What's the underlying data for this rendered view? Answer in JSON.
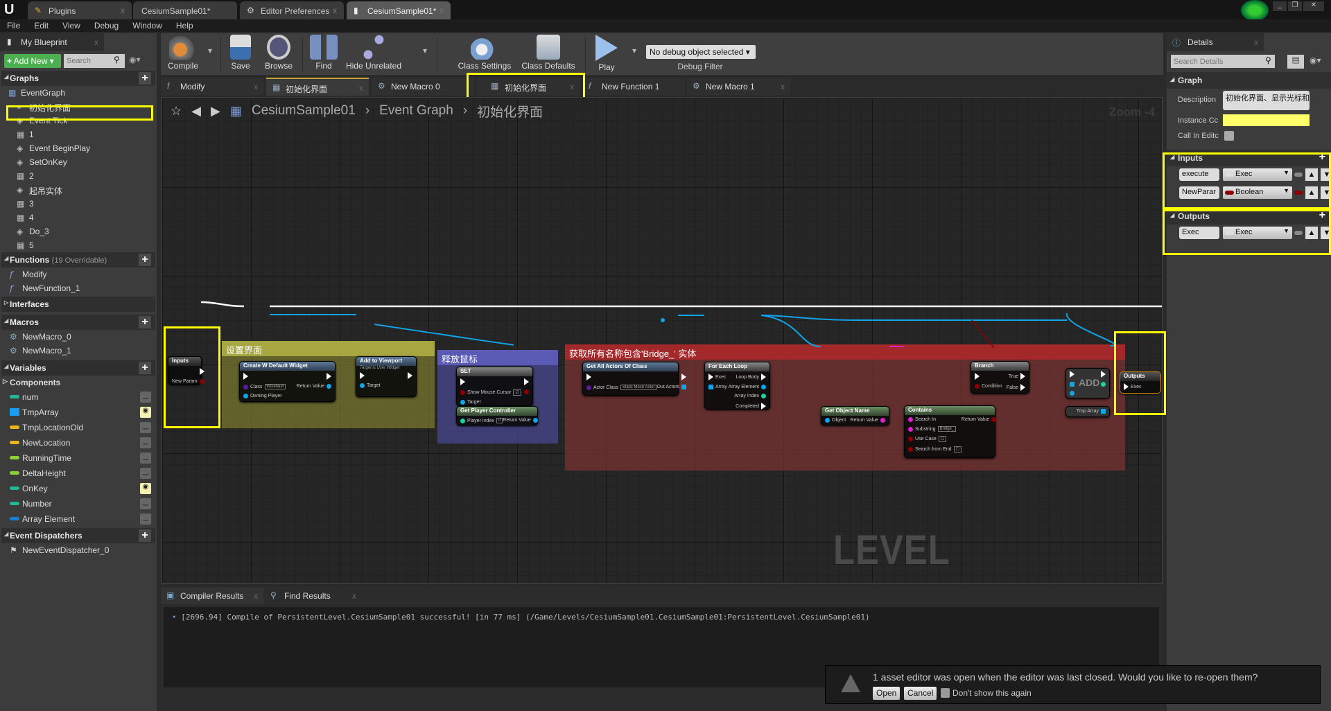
{
  "window_tabs": [
    {
      "label": "Plugins",
      "icon": "plug-icon"
    },
    {
      "label": "CesiumSample01*",
      "icon": ""
    },
    {
      "label": "Editor Preferences",
      "icon": "preferences-icon"
    },
    {
      "label": "CesiumSample01*",
      "icon": "blueprint-book-icon",
      "active": true
    }
  ],
  "menu": [
    "File",
    "Edit",
    "View",
    "Debug",
    "Window",
    "Help"
  ],
  "my_blueprint": {
    "tab": "My Blueprint",
    "add_new": "Add New",
    "search_placeholder": "Search",
    "graphs": {
      "title": "Graphs",
      "root": "EventGraph",
      "items": [
        {
          "label": "初始化界面",
          "icon": "custom-event-icon",
          "highlighted": true
        },
        {
          "label": "Event Tick",
          "icon": "event-icon"
        },
        {
          "label": "1",
          "icon": "comment-icon"
        },
        {
          "label": "Event BeginPlay",
          "icon": "event-icon"
        },
        {
          "label": "SetOnKey",
          "icon": "event-icon"
        },
        {
          "label": "2",
          "icon": "comment-icon"
        },
        {
          "label": "起吊实体",
          "icon": "event-icon"
        },
        {
          "label": "3",
          "icon": "comment-icon"
        },
        {
          "label": "4",
          "icon": "comment-icon"
        },
        {
          "label": "Do_3",
          "icon": "event-icon"
        },
        {
          "label": "5",
          "icon": "comment-icon"
        }
      ]
    },
    "functions": {
      "title": "Functions",
      "sub": "(19 Overridable)",
      "items": [
        "Modify",
        "NewFunction_1"
      ]
    },
    "interfaces": {
      "title": "Interfaces"
    },
    "macros": {
      "title": "Macros",
      "items": [
        "NewMacro_0",
        "NewMacro_1"
      ]
    },
    "variables": {
      "title": "Variables",
      "components": "Components",
      "items": [
        {
          "name": "num",
          "color": "#1fb99a",
          "public": false
        },
        {
          "name": "TmpArray",
          "color": "#1a9cf0",
          "array": true,
          "public": true
        },
        {
          "name": "TmpLocationOld",
          "color": "#e8b51c",
          "public": false
        },
        {
          "name": "NewLocation",
          "color": "#e8b51c",
          "public": false
        },
        {
          "name": "RunningTime",
          "color": "#8bd23a",
          "public": false
        },
        {
          "name": "DeltaHeight",
          "color": "#8bd23a",
          "public": false
        },
        {
          "name": "OnKey",
          "color": "#1fb99a",
          "public": true
        },
        {
          "name": "Number",
          "color": "#1fb99a",
          "public": false
        },
        {
          "name": "Array Element",
          "color": "#1a7fd0",
          "public": false
        }
      ]
    },
    "dispatchers": {
      "title": "Event Dispatchers",
      "items": [
        "NewEventDispatcher_0"
      ]
    }
  },
  "toolbar": {
    "compile": "Compile",
    "save": "Save",
    "browse": "Browse",
    "find": "Find",
    "hide_unrelated": "Hide Unrelated",
    "class_settings": "Class Settings",
    "class_defaults": "Class Defaults",
    "play": "Play",
    "debug_select": "No debug object selected",
    "debug_filter": "Debug Filter"
  },
  "graph_tabs": [
    {
      "label": "Modify",
      "icon": "function-icon"
    },
    {
      "label": "初始化界面",
      "icon": "graph-icon",
      "active": true
    },
    {
      "label": "New Macro 0",
      "icon": "macro-icon"
    },
    {
      "label": "初始化界面",
      "icon": "graph-icon",
      "highlighted": true
    },
    {
      "label": "New Function 1",
      "icon": "function-icon"
    },
    {
      "label": "New Macro 1",
      "icon": "macro-icon"
    }
  ],
  "breadcrumb": [
    "CesiumSample01",
    "Event Graph",
    "初始化界面"
  ],
  "zoom": "Zoom -4",
  "watermark": "LEVEL BLUEPRINT",
  "comments": {
    "setup": "设置界面",
    "release": "释放鼠标",
    "find": "获取所有名称包含'Bridge_' 实体"
  },
  "nodes": {
    "inputs": {
      "title": "Inputs",
      "style": "dark",
      "in": [],
      "out": [
        {
          "label": "",
          "type": "exec"
        },
        {
          "label": "New Param",
          "type": "bool"
        }
      ]
    },
    "create_widget": {
      "title": "Create W Default Widget",
      "style": "fn",
      "in": [
        {
          "label": "",
          "type": "exec"
        },
        {
          "label": "Class",
          "type": "class",
          "value": "WDefault"
        },
        {
          "label": "Owning Player",
          "type": "object"
        }
      ],
      "out": [
        {
          "label": "",
          "type": "exec"
        },
        {
          "label": "Return Value",
          "type": "object"
        }
      ]
    },
    "add_viewport": {
      "title": "Add to Viewport",
      "subtitle": "Target is User Widget",
      "style": "fn",
      "in": [
        {
          "label": "",
          "type": "exec"
        },
        {
          "label": "Target",
          "type": "object"
        }
      ],
      "out": [
        {
          "label": "",
          "type": "exec"
        }
      ]
    },
    "set": {
      "title": "SET",
      "style": "grey",
      "in": [
        {
          "label": "",
          "type": "exec"
        },
        {
          "label": "Show Mouse Cursor",
          "type": "bool",
          "value": "☑"
        },
        {
          "label": "Target",
          "type": "object"
        }
      ],
      "out": [
        {
          "label": "",
          "type": "exec"
        },
        {
          "label": "",
          "type": "bool"
        }
      ]
    },
    "get_pc": {
      "title": "Get Player Controller",
      "style": "pure",
      "in": [
        {
          "label": "Player Index",
          "type": "int",
          "value": "0"
        }
      ],
      "out": [
        {
          "label": "Return Value",
          "type": "object"
        }
      ]
    },
    "get_all": {
      "title": "Get All Actors Of Class",
      "style": "fn",
      "in": [
        {
          "label": "",
          "type": "exec"
        },
        {
          "label": "Actor Class",
          "type": "class",
          "value": "Static Mesh Actor"
        }
      ],
      "out": [
        {
          "label": "",
          "type": "exec"
        },
        {
          "label": "Out Actors",
          "type": "array"
        }
      ]
    },
    "foreach": {
      "title": "For Each Loop",
      "style": "grey",
      "in": [
        {
          "label": "Exec",
          "type": "exec"
        },
        {
          "label": "Array",
          "type": "array"
        }
      ],
      "out": [
        {
          "label": "Loop Body",
          "type": "exec"
        },
        {
          "label": "Array Element",
          "type": "object"
        },
        {
          "label": "Array Index",
          "type": "int"
        },
        {
          "label": "Completed",
          "type": "exec"
        }
      ]
    },
    "get_name": {
      "title": "Get Object Name",
      "style": "pure",
      "in": [
        {
          "label": "Object",
          "type": "object"
        }
      ],
      "out": [
        {
          "label": "Return Value",
          "type": "string"
        }
      ]
    },
    "contains": {
      "title": "Contains",
      "style": "pure",
      "in": [
        {
          "label": "Search In",
          "type": "string"
        },
        {
          "label": "Substring",
          "type": "string",
          "value": "Bridge_"
        },
        {
          "label": "Use Case",
          "type": "bool",
          "value": "☐"
        },
        {
          "label": "Search from End",
          "type": "bool",
          "value": "☐"
        }
      ],
      "out": [
        {
          "label": "Return Value",
          "type": "bool"
        }
      ]
    },
    "branch": {
      "title": "Branch",
      "style": "grey",
      "in": [
        {
          "label": "",
          "type": "exec"
        },
        {
          "label": "Condition",
          "type": "bool"
        }
      ],
      "out": [
        {
          "label": "True",
          "type": "exec"
        },
        {
          "label": "False",
          "type": "exec"
        }
      ]
    },
    "add": {
      "title": "ADD",
      "style": "none",
      "in": [
        {
          "label": "",
          "type": "exec"
        },
        {
          "label": "",
          "type": "array"
        },
        {
          "label": "",
          "type": "object"
        }
      ],
      "out": [
        {
          "label": "",
          "type": "exec"
        },
        {
          "label": "",
          "type": "int"
        }
      ]
    },
    "tmparray": {
      "title": "",
      "style": "none",
      "in": [],
      "out": [
        {
          "label": "Tmp Array",
          "type": "array"
        }
      ]
    },
    "outputs": {
      "title": "Outputs",
      "style": "dark",
      "in": [
        {
          "label": "Exec",
          "type": "exec"
        }
      ],
      "out": []
    }
  },
  "pin_colors": {
    "exec": "#ffffff",
    "object": "#0ea5e9",
    "bool": "#8c0000",
    "class": "#5a1aa0",
    "array": "#0ea5e9",
    "int": "#1fd0a0",
    "string": "#e020d0"
  },
  "bottom": {
    "tabs": [
      "Compiler Results",
      "Find Results"
    ],
    "log": "[2696.94] Compile of PersistentLevel.CesiumSample01 successful! [in 77 ms] (/Game/Levels/CesiumSample01.CesiumSample01:PersistentLevel.CesiumSample01)"
  },
  "details": {
    "tab": "Details",
    "search_placeholder": "Search Details",
    "graph": "Graph",
    "description_label": "Description",
    "description_value": "初始化界面、显示光标和",
    "instance_label": "Instance Cc",
    "call_in_editor_label": "Call In Editc",
    "inputs": {
      "title": "Inputs",
      "pins": [
        {
          "name": "execute",
          "type": "Exec",
          "color": "#dddddd"
        },
        {
          "name": "NewParar",
          "type": "Boolean",
          "color": "#8c0000"
        }
      ]
    },
    "outputs": {
      "title": "Outputs",
      "pins": [
        {
          "name": "Exec",
          "type": "Exec",
          "color": "#dddddd"
        }
      ]
    }
  },
  "notification": {
    "message": "1 asset editor was open when the editor was last closed. Would you like to re-open them?",
    "open": "Open",
    "cancel": "Cancel",
    "dont_show": "Don't show this again"
  }
}
